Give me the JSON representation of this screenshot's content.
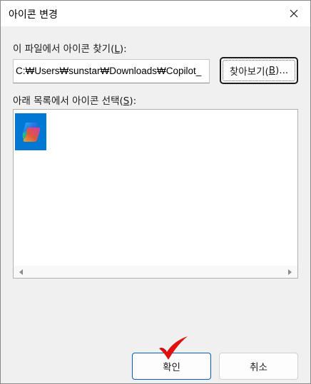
{
  "window": {
    "title": "아이콘 변경",
    "close_glyph": "✕"
  },
  "file_section": {
    "label_prefix": "이 파일에서 아이콘 찾기(",
    "label_key": "L",
    "label_suffix": "):",
    "path_value": "C:₩Users₩sunstar₩Downloads₩Copilot_",
    "browse_prefix": "찾아보기(",
    "browse_key": "B",
    "browse_suffix": ")..."
  },
  "list_section": {
    "label_prefix": "아래 목록에서 아이콘 선택(",
    "label_key": "S",
    "label_suffix": "):",
    "icons": [
      {
        "name": "copilot-icon",
        "selected": true
      }
    ]
  },
  "buttons": {
    "ok_label": "확인",
    "cancel_label": "취소"
  },
  "colors": {
    "accent": "#0078d4",
    "annotation": "#e01010"
  }
}
